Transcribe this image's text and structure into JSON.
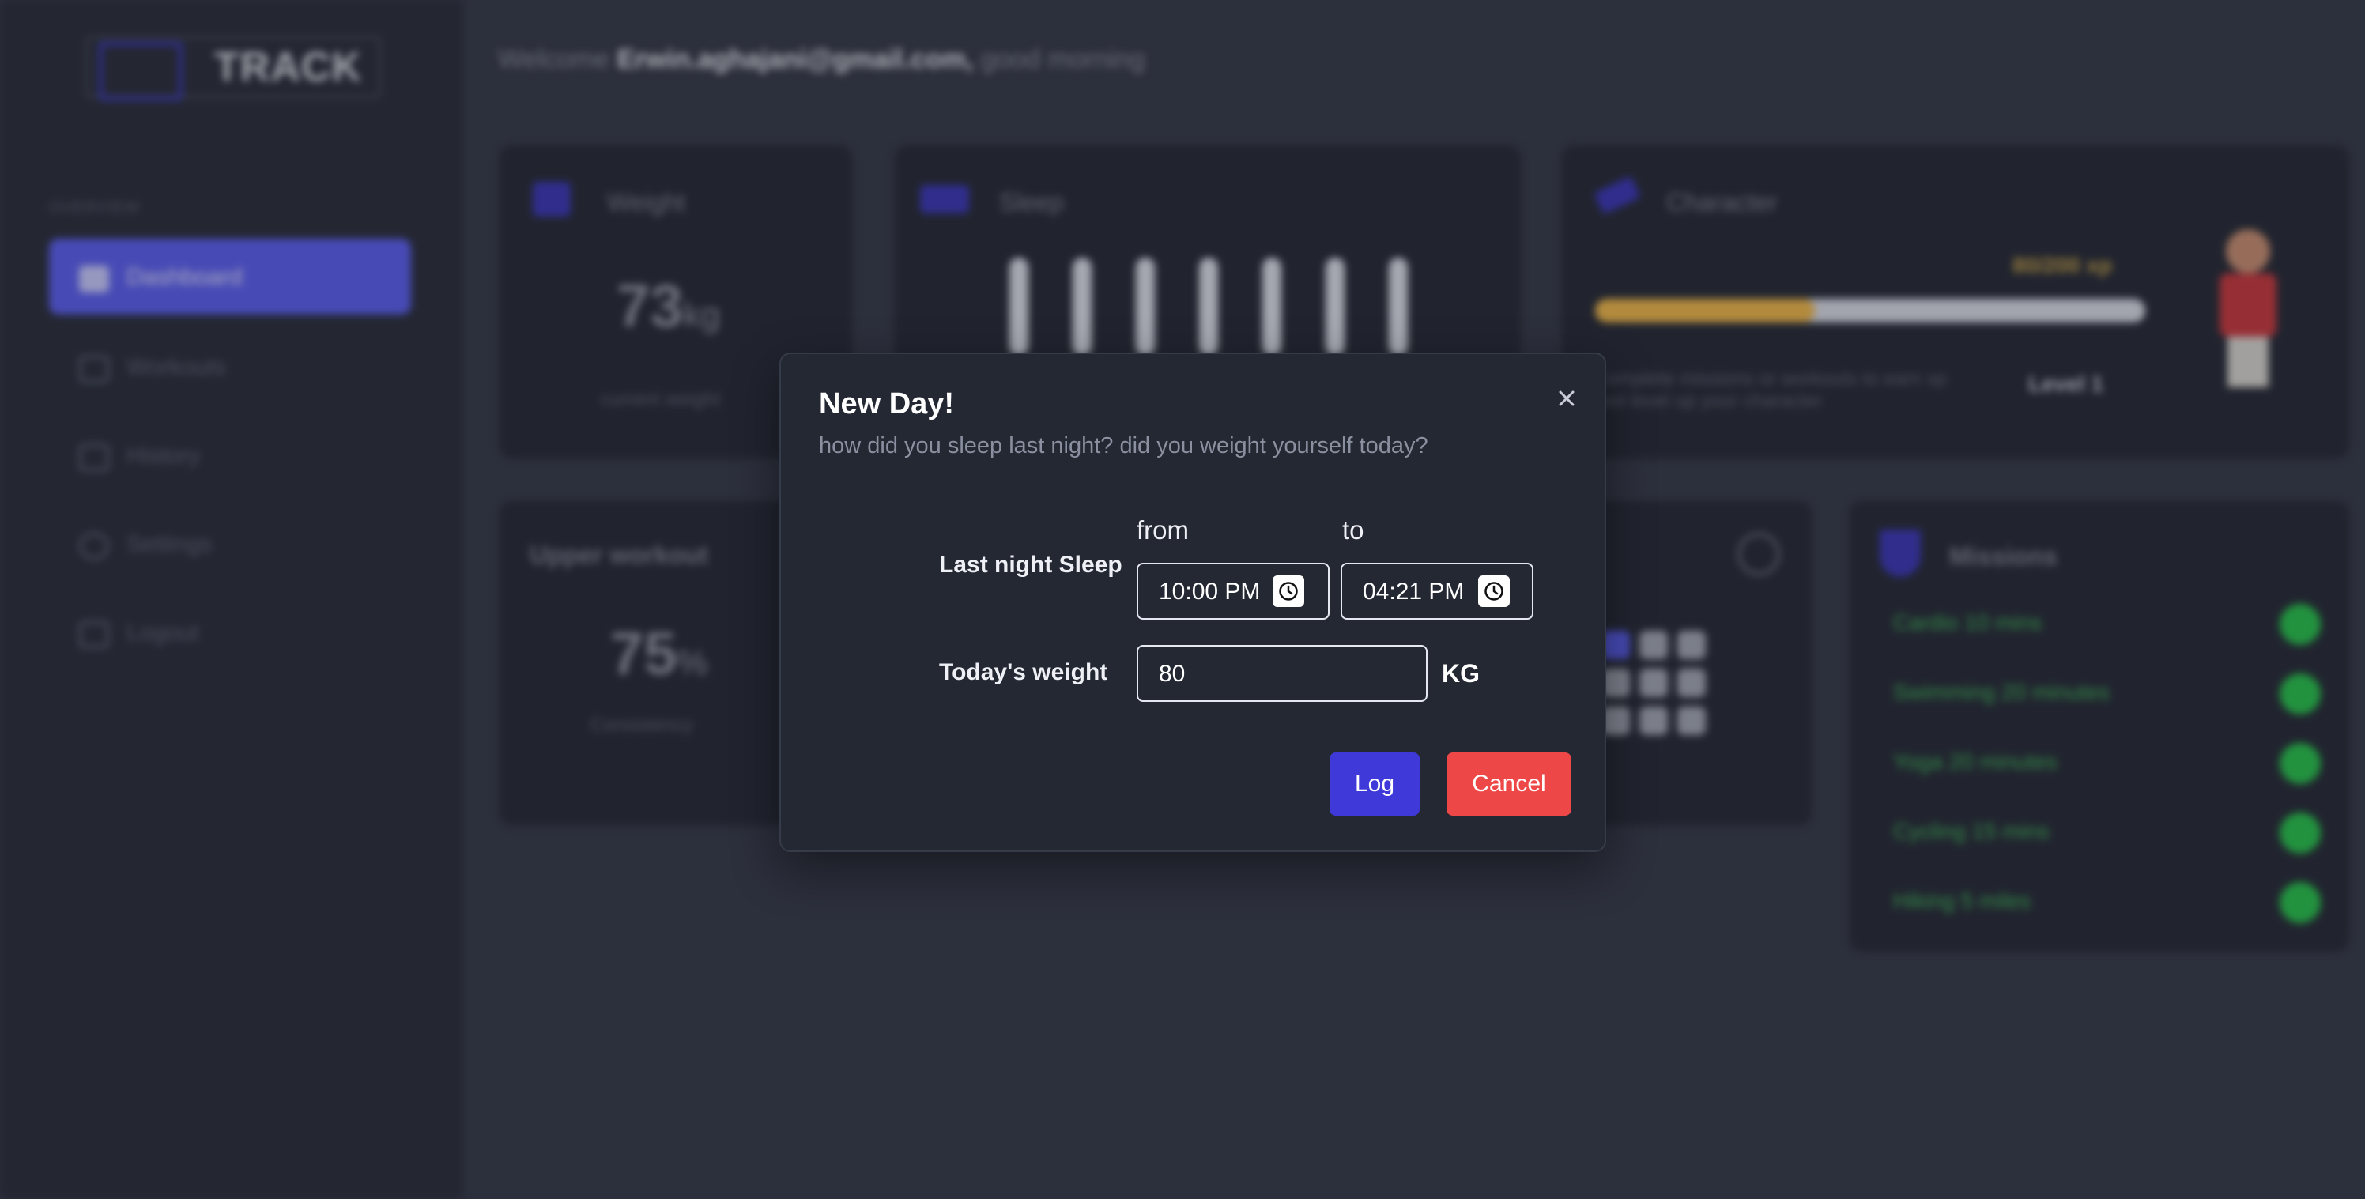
{
  "app": {
    "logo_text": "TRACK"
  },
  "sidebar": {
    "section_label": "OVERVIEW",
    "items": [
      {
        "label": "Dashboard",
        "icon": "dashboard-icon",
        "active": true
      },
      {
        "label": "Workouts",
        "icon": "dumbbell-icon",
        "active": false
      },
      {
        "label": "History",
        "icon": "chart-icon",
        "active": false
      },
      {
        "label": "Settings",
        "icon": "gear-icon",
        "active": false
      },
      {
        "label": "Logout",
        "icon": "logout-icon",
        "active": false
      }
    ]
  },
  "header": {
    "welcome_prefix": "Welcome",
    "email": "Erwin.aghajani@gmail.com,",
    "greeting": "good morning"
  },
  "cards": {
    "weight": {
      "title": "Weight",
      "value": "73",
      "unit": "kg",
      "caption": "current weight"
    },
    "sleep": {
      "title": "Sleep"
    },
    "character": {
      "title": "Character",
      "xp_label": "80/200 xp",
      "xp_fraction": 0.4,
      "description_line1": "Complete missions or workouts to earn xp",
      "description_line2": "and level up your character",
      "level": "Level 1"
    },
    "workout": {
      "title": "Upper workout",
      "value": "75",
      "unit": "%",
      "caption": "Consistency"
    },
    "missions": {
      "title": "Missions",
      "items": [
        "Cardio 10 mins",
        "Swimming 20 minutes",
        "Yoga 20 minutes",
        "Cycling 15 mins",
        "Hiking 5 miles"
      ]
    }
  },
  "modal": {
    "title": "New Day!",
    "subtitle": "how did you sleep last night? did you weight yourself today?",
    "sleep_label": "Last night Sleep",
    "from_label": "from",
    "to_label": "to",
    "from_value": "10:00 PM",
    "to_value": "04:21 PM",
    "weight_label": "Today's weight",
    "weight_value": "80",
    "weight_unit": "KG",
    "log_label": "Log",
    "cancel_label": "Cancel"
  },
  "colors": {
    "accent": "#5b5ff0",
    "log_button": "#4039d9",
    "cancel_button": "#ee4747",
    "xp_fill": "#f0b84a",
    "mission_done": "#27c24c"
  }
}
